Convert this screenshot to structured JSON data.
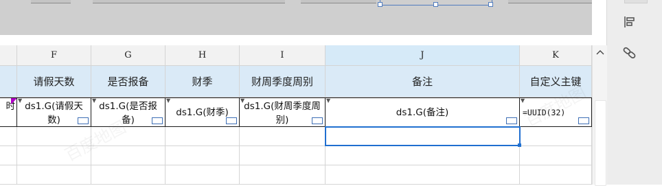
{
  "columns": [
    {
      "letter": ""
    },
    {
      "letter": "F"
    },
    {
      "letter": "G"
    },
    {
      "letter": "H"
    },
    {
      "letter": "I"
    },
    {
      "letter": "J"
    },
    {
      "letter": "K"
    }
  ],
  "header_row": [
    "",
    "请假天数",
    "是否报备",
    "财季",
    "财周季度周别",
    "备注",
    "自定义主键"
  ],
  "data_row": [
    "时",
    "ds1.G(请假天数)",
    "ds1.G(是否报备)",
    "ds1.G(财季)",
    "ds1.G(财周季度周别)",
    "ds1.G(备注)",
    "=UUID(32)"
  ],
  "watermark": "百度地图",
  "colors": {
    "accent": "#1f6fd0",
    "header_fill": "#daeaf7",
    "selected_col": "#d6eaf8",
    "flag": "#b000c8"
  },
  "icons": {
    "panel_top": "align-icon",
    "panel_mid": "link-icon",
    "scroll": "chevron-up-icon"
  }
}
